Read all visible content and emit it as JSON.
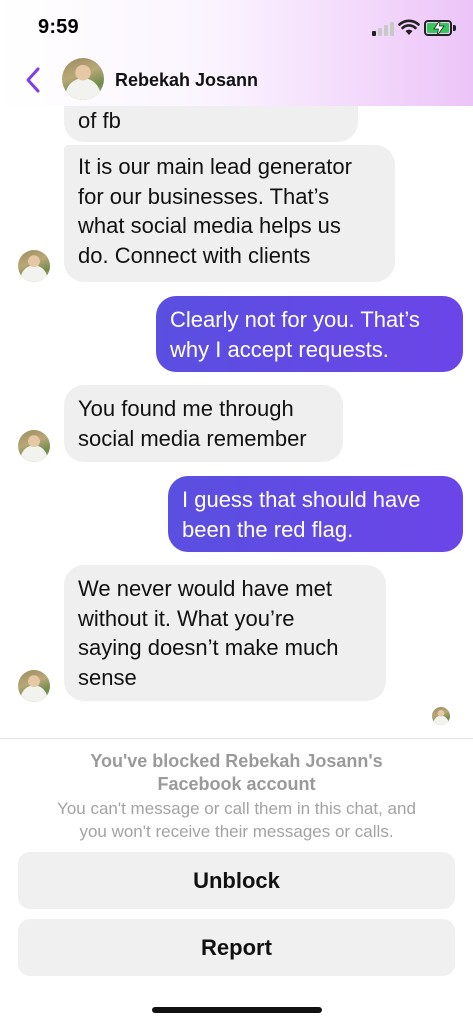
{
  "status_bar": {
    "time": "9:59",
    "signal_bars_on": 1
  },
  "header": {
    "contact_name": "Rebekah Josann"
  },
  "messages": [
    {
      "direction": "incoming",
      "lines": [
        "of fb"
      ],
      "show_avatar": false
    },
    {
      "direction": "incoming",
      "lines": [
        "It is our main lead generator",
        "for our businesses. That’s",
        "what social media helps us",
        "do. Connect with clients"
      ],
      "show_avatar": true
    },
    {
      "direction": "outgoing",
      "lines": [
        "Clearly not for you. That’s",
        "why I accept requests."
      ]
    },
    {
      "direction": "incoming",
      "lines": [
        "You found me through",
        "social media remember"
      ],
      "show_avatar": true
    },
    {
      "direction": "outgoing",
      "lines": [
        "I guess that should have",
        "been the red flag."
      ]
    },
    {
      "direction": "incoming",
      "lines": [
        "We never would have met",
        "without it. What you’re",
        "saying doesn’t make much",
        "sense"
      ],
      "show_avatar": true
    }
  ],
  "blocked": {
    "title_line1": "You've blocked Rebekah Josann's",
    "title_line2": "Facebook account",
    "desc_line1": "You can't message or call them in this chat, and",
    "desc_line2": "you won't receive their messages or calls.",
    "unblock_label": "Unblock",
    "report_label": "Report"
  },
  "colors": {
    "outgoing_bubble": "#5a4fe0",
    "incoming_bubble": "#efefef",
    "accent": "#7b3fe4"
  },
  "icons": {
    "back": "chevron-left-icon",
    "wifi": "wifi-icon",
    "battery": "battery-charging-icon",
    "signal": "cellular-signal-icon"
  }
}
